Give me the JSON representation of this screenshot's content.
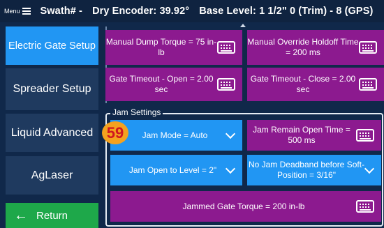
{
  "topbar": {
    "menu_label": "Menu",
    "swath": "Swath# -",
    "encoder": "Dry Encoder: 39.92°",
    "base_level": "Base Level: 1 1/2\"  0 (Trim) - 8 (GPS)"
  },
  "nav": {
    "electric_gate": "Electric Gate Setup",
    "spreader": "Spreader Setup",
    "liquid": "Liquid Advanced",
    "aglaser": "AgLaser",
    "return": "Return"
  },
  "settings": {
    "manual_dump_torque": "Manual Dump Torque = 75 in-lb",
    "manual_override_holdoff": "Manual Override Holdoff Time = 200 ms",
    "gate_timeout_open": "Gate Timeout - Open = 2.00 sec",
    "gate_timeout_close": "Gate Timeout - Close = 2.00 sec"
  },
  "jam": {
    "group_title": "Jam Settings",
    "badge": "59",
    "mode": "Jam Mode = Auto",
    "remain_open": "Jam Remain Open Time = 500 ms",
    "open_to_level": "Jam Open to Level = 2\"",
    "no_deadband": "No Jam Deadband before Soft-Position = 3/16\"",
    "gate_torque": "Jammed Gate Torque = 200 in-lb"
  },
  "icons": {
    "menu": "hamburger-icon",
    "keyboard": "keyboard-icon",
    "dropdown": "chevron-down-icon",
    "return": "arrow-left-icon"
  },
  "colors": {
    "purple": "#8c1a8f",
    "blue": "#2196f3",
    "green": "#1ea84a",
    "badge": "#f4a21f"
  }
}
